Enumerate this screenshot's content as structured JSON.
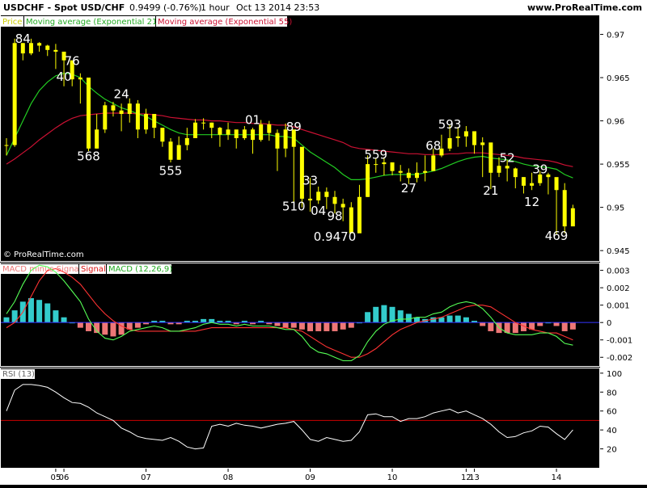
{
  "header": {
    "symbol": "USDCHF - Spot USD/CHF",
    "quote": "0.9499 (-0.76%)",
    "timeframe": "1 hour",
    "datetime": "Oct 13 2014 23:53",
    "site": "www.ProRealTime.com"
  },
  "watermark": "© ProRealTime.com",
  "colors": {
    "background": "#000000",
    "frame": "#ffffff",
    "candle": "#ffff00",
    "ema21": "#22cc22",
    "ema55": "#cc1133",
    "macd": "#55ff55",
    "signal": "#ff3333",
    "hist_pos": "#33cccc",
    "hist_neg": "#ee7777",
    "rsi": "#ffffff",
    "rsi_level": "#cc0000",
    "zero_line": "#3333ff"
  },
  "chart_data": [
    {
      "type": "candlestick",
      "legend": [
        "Price",
        "Moving average (Exponential 21)",
        "Moving average (Exponential 55)"
      ],
      "ylim": [
        0.9438,
        0.9722
      ],
      "yticks": [
        0.945,
        0.95,
        0.955,
        0.96,
        0.965,
        0.97
      ],
      "ytick_labels": [
        "0.945",
        "0.95",
        "0.955",
        "0.96",
        "0.965",
        "0.97"
      ],
      "x_labels": [
        "05",
        "06",
        "07",
        "08",
        "09",
        "10",
        "12",
        "13",
        "14"
      ],
      "x_label_bars": [
        6,
        7,
        17,
        27,
        37,
        47,
        56,
        57,
        67
      ],
      "close": [
        0.9572,
        0.969,
        0.9678,
        0.969,
        0.9687,
        0.9682,
        0.968,
        0.967,
        0.9648,
        0.965,
        0.9568,
        0.959,
        0.9618,
        0.9612,
        0.9608,
        0.962,
        0.959,
        0.9608,
        0.9592,
        0.9576,
        0.9555,
        0.9572,
        0.958,
        0.9598,
        0.9598,
        0.9592,
        0.9584,
        0.959,
        0.958,
        0.959,
        0.9578,
        0.9596,
        0.9586,
        0.9568,
        0.959,
        0.957,
        0.951,
        0.9508,
        0.9518,
        0.9512,
        0.9504,
        0.95,
        0.947,
        0.9512,
        0.955,
        0.955,
        0.9552,
        0.9542,
        0.954,
        0.9534,
        0.954,
        0.9542,
        0.956,
        0.9568,
        0.958,
        0.9582,
        0.9588,
        0.9572,
        0.9575,
        0.954,
        0.9548,
        0.9545,
        0.9535,
        0.9525,
        0.9528,
        0.9538,
        0.9535,
        0.952,
        0.9478,
        0.9499
      ],
      "high": [
        0.958,
        0.9695,
        0.969,
        0.9695,
        0.9691,
        0.9688,
        0.9689,
        0.9676,
        0.9655,
        0.9655,
        0.9626,
        0.9608,
        0.9622,
        0.9622,
        0.962,
        0.9626,
        0.9624,
        0.9614,
        0.9608,
        0.959,
        0.958,
        0.9582,
        0.9592,
        0.9602,
        0.9603,
        0.9598,
        0.9593,
        0.9598,
        0.9588,
        0.9594,
        0.9592,
        0.9601,
        0.96,
        0.959,
        0.9597,
        0.959,
        0.9548,
        0.9534,
        0.9524,
        0.9523,
        0.9519,
        0.951,
        0.9506,
        0.9526,
        0.956,
        0.9557,
        0.9558,
        0.9552,
        0.9549,
        0.9545,
        0.9552,
        0.956,
        0.9568,
        0.9584,
        0.9595,
        0.9593,
        0.9594,
        0.9585,
        0.9581,
        0.9566,
        0.9558,
        0.9555,
        0.9546,
        0.9535,
        0.954,
        0.9542,
        0.954,
        0.9534,
        0.9528,
        0.9503
      ],
      "low": [
        0.956,
        0.957,
        0.967,
        0.9676,
        0.968,
        0.9675,
        0.966,
        0.964,
        0.964,
        0.962,
        0.9565,
        0.9568,
        0.9586,
        0.9605,
        0.9588,
        0.9598,
        0.958,
        0.9585,
        0.958,
        0.957,
        0.9552,
        0.9555,
        0.9566,
        0.958,
        0.959,
        0.958,
        0.957,
        0.9578,
        0.9568,
        0.9578,
        0.9562,
        0.9576,
        0.9577,
        0.9542,
        0.9558,
        0.9505,
        0.95,
        0.9495,
        0.9504,
        0.9498,
        0.9493,
        0.9484,
        0.947,
        0.95,
        0.9512,
        0.954,
        0.9537,
        0.9537,
        0.953,
        0.9527,
        0.9529,
        0.953,
        0.9548,
        0.9558,
        0.9565,
        0.957,
        0.957,
        0.9562,
        0.9535,
        0.9521,
        0.9535,
        0.953,
        0.9522,
        0.9516,
        0.952,
        0.9525,
        0.9515,
        0.9469,
        0.947,
        0.9485
      ],
      "ema21": [
        0.956,
        0.958,
        0.96,
        0.962,
        0.9635,
        0.9645,
        0.9652,
        0.9655,
        0.9654,
        0.965,
        0.964,
        0.9632,
        0.9625,
        0.962,
        0.9615,
        0.9612,
        0.9608,
        0.9605,
        0.96,
        0.9595,
        0.959,
        0.9586,
        0.9584,
        0.9584,
        0.9584,
        0.9584,
        0.9584,
        0.9584,
        0.9584,
        0.9584,
        0.9584,
        0.9584,
        0.9584,
        0.9582,
        0.9582,
        0.958,
        0.9572,
        0.9564,
        0.9558,
        0.9552,
        0.9546,
        0.9538,
        0.9532,
        0.9532,
        0.9533,
        0.9535,
        0.9537,
        0.9538,
        0.9538,
        0.9538,
        0.9538,
        0.954,
        0.9542,
        0.9545,
        0.9549,
        0.9553,
        0.9556,
        0.9558,
        0.9559,
        0.9557,
        0.9556,
        0.9555,
        0.9553,
        0.955,
        0.9548,
        0.9547,
        0.9546,
        0.9544,
        0.9538,
        0.9534
      ],
      "ema55": [
        0.955,
        0.9556,
        0.9563,
        0.957,
        0.9578,
        0.9585,
        0.9592,
        0.9598,
        0.9603,
        0.9606,
        0.9607,
        0.9608,
        0.9609,
        0.9609,
        0.9609,
        0.9609,
        0.9608,
        0.9608,
        0.9607,
        0.9606,
        0.9604,
        0.9603,
        0.9602,
        0.9601,
        0.9601,
        0.96,
        0.96,
        0.9599,
        0.9598,
        0.9598,
        0.9597,
        0.9597,
        0.9596,
        0.9595,
        0.9595,
        0.9593,
        0.959,
        0.9587,
        0.9584,
        0.9581,
        0.9578,
        0.9575,
        0.957,
        0.9568,
        0.9567,
        0.9566,
        0.9565,
        0.9564,
        0.9563,
        0.9562,
        0.9562,
        0.9561,
        0.9561,
        0.9561,
        0.9562,
        0.9562,
        0.9563,
        0.9563,
        0.9563,
        0.9562,
        0.9561,
        0.956,
        0.9559,
        0.9557,
        0.9556,
        0.9555,
        0.9554,
        0.9552,
        0.9549,
        0.9547
      ],
      "annotations": [
        {
          "text": "84",
          "bar": 2,
          "price": 0.9696
        },
        {
          "text": "76",
          "bar": 8,
          "price": 0.967
        },
        {
          "text": "40",
          "bar": 7,
          "price": 0.9652
        },
        {
          "text": "568",
          "bar": 10,
          "price": 0.956
        },
        {
          "text": "24",
          "bar": 14,
          "price": 0.9632
        },
        {
          "text": "555",
          "bar": 20,
          "price": 0.9543
        },
        {
          "text": "01",
          "bar": 30,
          "price": 0.9602
        },
        {
          "text": "89",
          "bar": 35,
          "price": 0.9594
        },
        {
          "text": "33",
          "bar": 37,
          "price": 0.9532
        },
        {
          "text": "510",
          "bar": 35,
          "price": 0.9502
        },
        {
          "text": "04",
          "bar": 38,
          "price": 0.9497
        },
        {
          "text": "98",
          "bar": 40,
          "price": 0.9491
        },
        {
          "text": "0.9470",
          "bar": 40,
          "price": 0.9467
        },
        {
          "text": "559",
          "bar": 45,
          "price": 0.9562
        },
        {
          "text": "68",
          "bar": 52,
          "price": 0.9572
        },
        {
          "text": "27",
          "bar": 49,
          "price": 0.9523
        },
        {
          "text": "593",
          "bar": 54,
          "price": 0.9597
        },
        {
          "text": "52",
          "bar": 61,
          "price": 0.9558
        },
        {
          "text": "21",
          "bar": 59,
          "price": 0.952
        },
        {
          "text": "39",
          "bar": 65,
          "price": 0.9545
        },
        {
          "text": "12",
          "bar": 64,
          "price": 0.9507
        },
        {
          "text": "469",
          "bar": 67,
          "price": 0.9468
        }
      ]
    },
    {
      "type": "line+bar",
      "legend": [
        "MACD minus Signal",
        "Signal",
        "MACD (12,26,9)"
      ],
      "ylim": [
        -0.0025,
        0.0034
      ],
      "yticks": [
        -0.002,
        -0.001,
        0,
        0.001,
        0.002,
        0.003
      ],
      "ytick_labels": [
        "-0.002",
        "-0.001",
        "0",
        "0.001",
        "0.002",
        "0.003"
      ],
      "macd": [
        0.0005,
        0.0012,
        0.0022,
        0.003,
        0.0033,
        0.0032,
        0.0029,
        0.0024,
        0.0018,
        0.0012,
        0.0002,
        -0.0005,
        -0.0009,
        -0.001,
        -0.0008,
        -0.0005,
        -0.0004,
        -0.0003,
        -0.0002,
        -0.0003,
        -0.0005,
        -0.0005,
        -0.0004,
        -0.0003,
        -0.0001,
        0.0,
        -0.0001,
        -0.0001,
        -0.0002,
        -0.0001,
        -0.0002,
        -0.0002,
        -0.0002,
        -0.0003,
        -0.0004,
        -0.0004,
        -0.0008,
        -0.0014,
        -0.0017,
        -0.0018,
        -0.002,
        -0.0022,
        -0.0022,
        -0.0019,
        -0.0011,
        -0.0005,
        -0.0001,
        0.0001,
        0.0002,
        0.0002,
        0.0003,
        0.0003,
        0.0005,
        0.0006,
        0.0009,
        0.0011,
        0.0012,
        0.0011,
        0.0008,
        0.0003,
        -0.0003,
        -0.0006,
        -0.0007,
        -0.0007,
        -0.0007,
        -0.0006,
        -0.0006,
        -0.0008,
        -0.0012,
        -0.0013
      ],
      "signal": [
        -0.0003,
        0.0,
        0.0006,
        0.0015,
        0.0024,
        0.003,
        0.0031,
        0.0029,
        0.0026,
        0.0022,
        0.0016,
        0.001,
        0.0005,
        0.0001,
        -0.0002,
        -0.0004,
        -0.0005,
        -0.0005,
        -0.0005,
        -0.0005,
        -0.0005,
        -0.0005,
        -0.0005,
        -0.0005,
        -0.0004,
        -0.0003,
        -0.0003,
        -0.0003,
        -0.0003,
        -0.0003,
        -0.0003,
        -0.0003,
        -0.0003,
        -0.0003,
        -0.0003,
        -0.0004,
        -0.0005,
        -0.0008,
        -0.0011,
        -0.0014,
        -0.0016,
        -0.0018,
        -0.002,
        -0.002,
        -0.0018,
        -0.0015,
        -0.0011,
        -0.0007,
        -0.0004,
        -0.0002,
        0.0,
        0.0001,
        0.0002,
        0.0003,
        0.0005,
        0.0007,
        0.0009,
        0.001,
        0.001,
        0.0009,
        0.0006,
        0.0003,
        0.0,
        -0.0002,
        -0.0004,
        -0.0005,
        -0.0006,
        -0.0006,
        -0.0008,
        -0.001
      ],
      "hist": [
        0.0003,
        0.0007,
        0.0012,
        0.0014,
        0.0013,
        0.0011,
        0.0007,
        0.0003,
        0.0,
        -0.0003,
        -0.0005,
        -0.0006,
        -0.0007,
        -0.0008,
        -0.0007,
        -0.0004,
        -0.0003,
        -0.0001,
        0.0001,
        0.0001,
        -0.0001,
        -0.0001,
        0.0001,
        0.0001,
        0.0002,
        0.0002,
        0.0001,
        0.0001,
        -0.0001,
        0.0001,
        -0.0001,
        0.0001,
        -0.0001,
        -0.0002,
        -0.0003,
        -0.0003,
        -0.0004,
        -0.0005,
        -0.0005,
        -0.0005,
        -0.0005,
        -0.0004,
        -0.0003,
        0.0,
        0.0006,
        0.0009,
        0.001,
        0.0009,
        0.0007,
        0.0005,
        0.0003,
        0.0002,
        0.0003,
        0.0003,
        0.0004,
        0.0004,
        0.0003,
        0.0001,
        -0.0002,
        -0.0005,
        -0.0006,
        -0.0006,
        -0.0006,
        -0.0005,
        -0.0004,
        -0.0002,
        0.0,
        -0.0002,
        -0.0005,
        -0.0004
      ]
    },
    {
      "type": "line",
      "legend": [
        "RSI (13)"
      ],
      "ylim": [
        0,
        105
      ],
      "yticks": [
        20,
        40,
        60,
        80,
        100
      ],
      "ytick_labels": [
        "20",
        "40",
        "60",
        "80",
        "100"
      ],
      "level": 50,
      "rsi": [
        60,
        82,
        88,
        88,
        87,
        85,
        80,
        74,
        69,
        68,
        64,
        58,
        54,
        50,
        42,
        38,
        33,
        31,
        30,
        29,
        32,
        28,
        22,
        20,
        21,
        44,
        46,
        44,
        47,
        45,
        44,
        42,
        44,
        46,
        47,
        49,
        40,
        30,
        28,
        32,
        30,
        28,
        29,
        38,
        56,
        57,
        54,
        54,
        49,
        52,
        52,
        54,
        58,
        60,
        62,
        58,
        60,
        56,
        52,
        46,
        38,
        32,
        33,
        37,
        39,
        44,
        43,
        36,
        30,
        40
      ]
    }
  ]
}
